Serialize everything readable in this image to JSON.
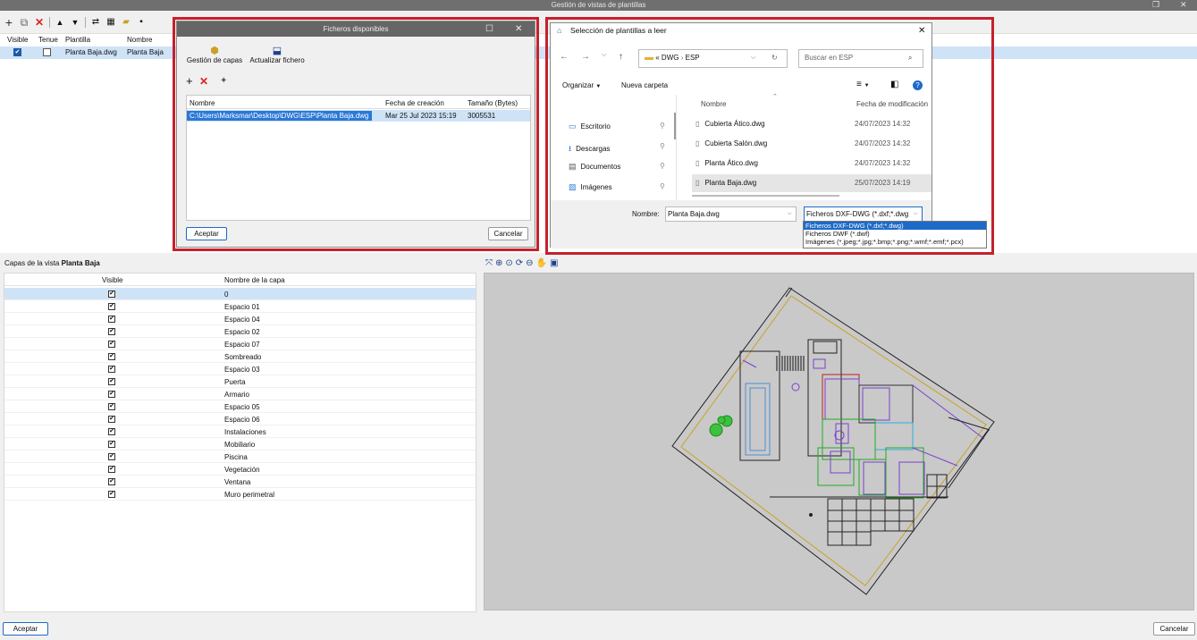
{
  "window": {
    "title": "Gestión de vistas de plantillas"
  },
  "tpl_table": {
    "headers": [
      "Visible",
      "Tenue",
      "Plantilla",
      "Nombre"
    ],
    "row": {
      "visible": true,
      "tenue": false,
      "plantilla": "Planta Baja.dwg",
      "nombre": "Planta Baja"
    }
  },
  "layers": {
    "title_prefix": "Capas de la vista",
    "title_value": "Planta Baja",
    "headers": [
      "Visible",
      "Nombre de la capa"
    ],
    "rows": [
      "0",
      "Espacio 01",
      "Espacio 04",
      "Espacio 02",
      "Espacio 07",
      "Sombreado",
      "Espacio 03",
      "Puerta",
      "Armario",
      "Espacio 05",
      "Espacio 06",
      "Instalaciones",
      "Mobiliario",
      "Piscina",
      "Vegetación",
      "Ventana",
      "Muro perimetral"
    ]
  },
  "bottom": {
    "accept": "Aceptar",
    "cancel": "Cancelar"
  },
  "files_dialog": {
    "title": "Ficheros disponibles",
    "tool_layers": "Gestión de capas",
    "tool_update": "Actualizar fichero",
    "headers": [
      "Nombre",
      "Fecha de creación",
      "Tamaño (Bytes)"
    ],
    "row": {
      "name": "C:\\Users\\Marksmar\\Desktop\\DWG\\ESP\\Planta Baja.dwg",
      "date": "Mar 25 Jul 2023  15:19",
      "size": "3005531"
    },
    "accept": "Aceptar",
    "cancel": "Cancelar"
  },
  "select_dialog": {
    "title": "Selección de plantillas a leer",
    "breadcrumb_prefix": "«",
    "breadcrumb": [
      "DWG",
      "ESP"
    ],
    "search_placeholder": "Buscar en ESP",
    "organize": "Organizar",
    "new_folder": "Nueva carpeta",
    "col_name": "Nombre",
    "col_modified": "Fecha de modificación",
    "nav_items": [
      "Escritorio",
      "Descargas",
      "Documentos",
      "Imágenes"
    ],
    "files": [
      {
        "name": "Cubierta Ático.dwg",
        "date": "24/07/2023 14:32"
      },
      {
        "name": "Cubierta Salón.dwg",
        "date": "24/07/2023 14:32"
      },
      {
        "name": "Planta Ático.dwg",
        "date": "24/07/2023 14:32"
      },
      {
        "name": "Planta Baja.dwg",
        "date": "25/07/2023 14:19"
      }
    ],
    "name_label": "Nombre:",
    "name_value": "Planta Baja.dwg",
    "filter_value": "Ficheros DXF-DWG (*.dxf;*.dwg",
    "filter_options": [
      "Ficheros DXF-DWG (*.dxf;*.dwg)",
      "Ficheros DWF (*.dwf)",
      "Imágenes (*.jpeg;*.jpg;*.bmp;*.png;*.wmf;*.emf;*.pcx)"
    ]
  },
  "colors": {
    "accent": "#1d6ac8",
    "highlight": "#cfe3f7",
    "frame": "#c7202c"
  }
}
